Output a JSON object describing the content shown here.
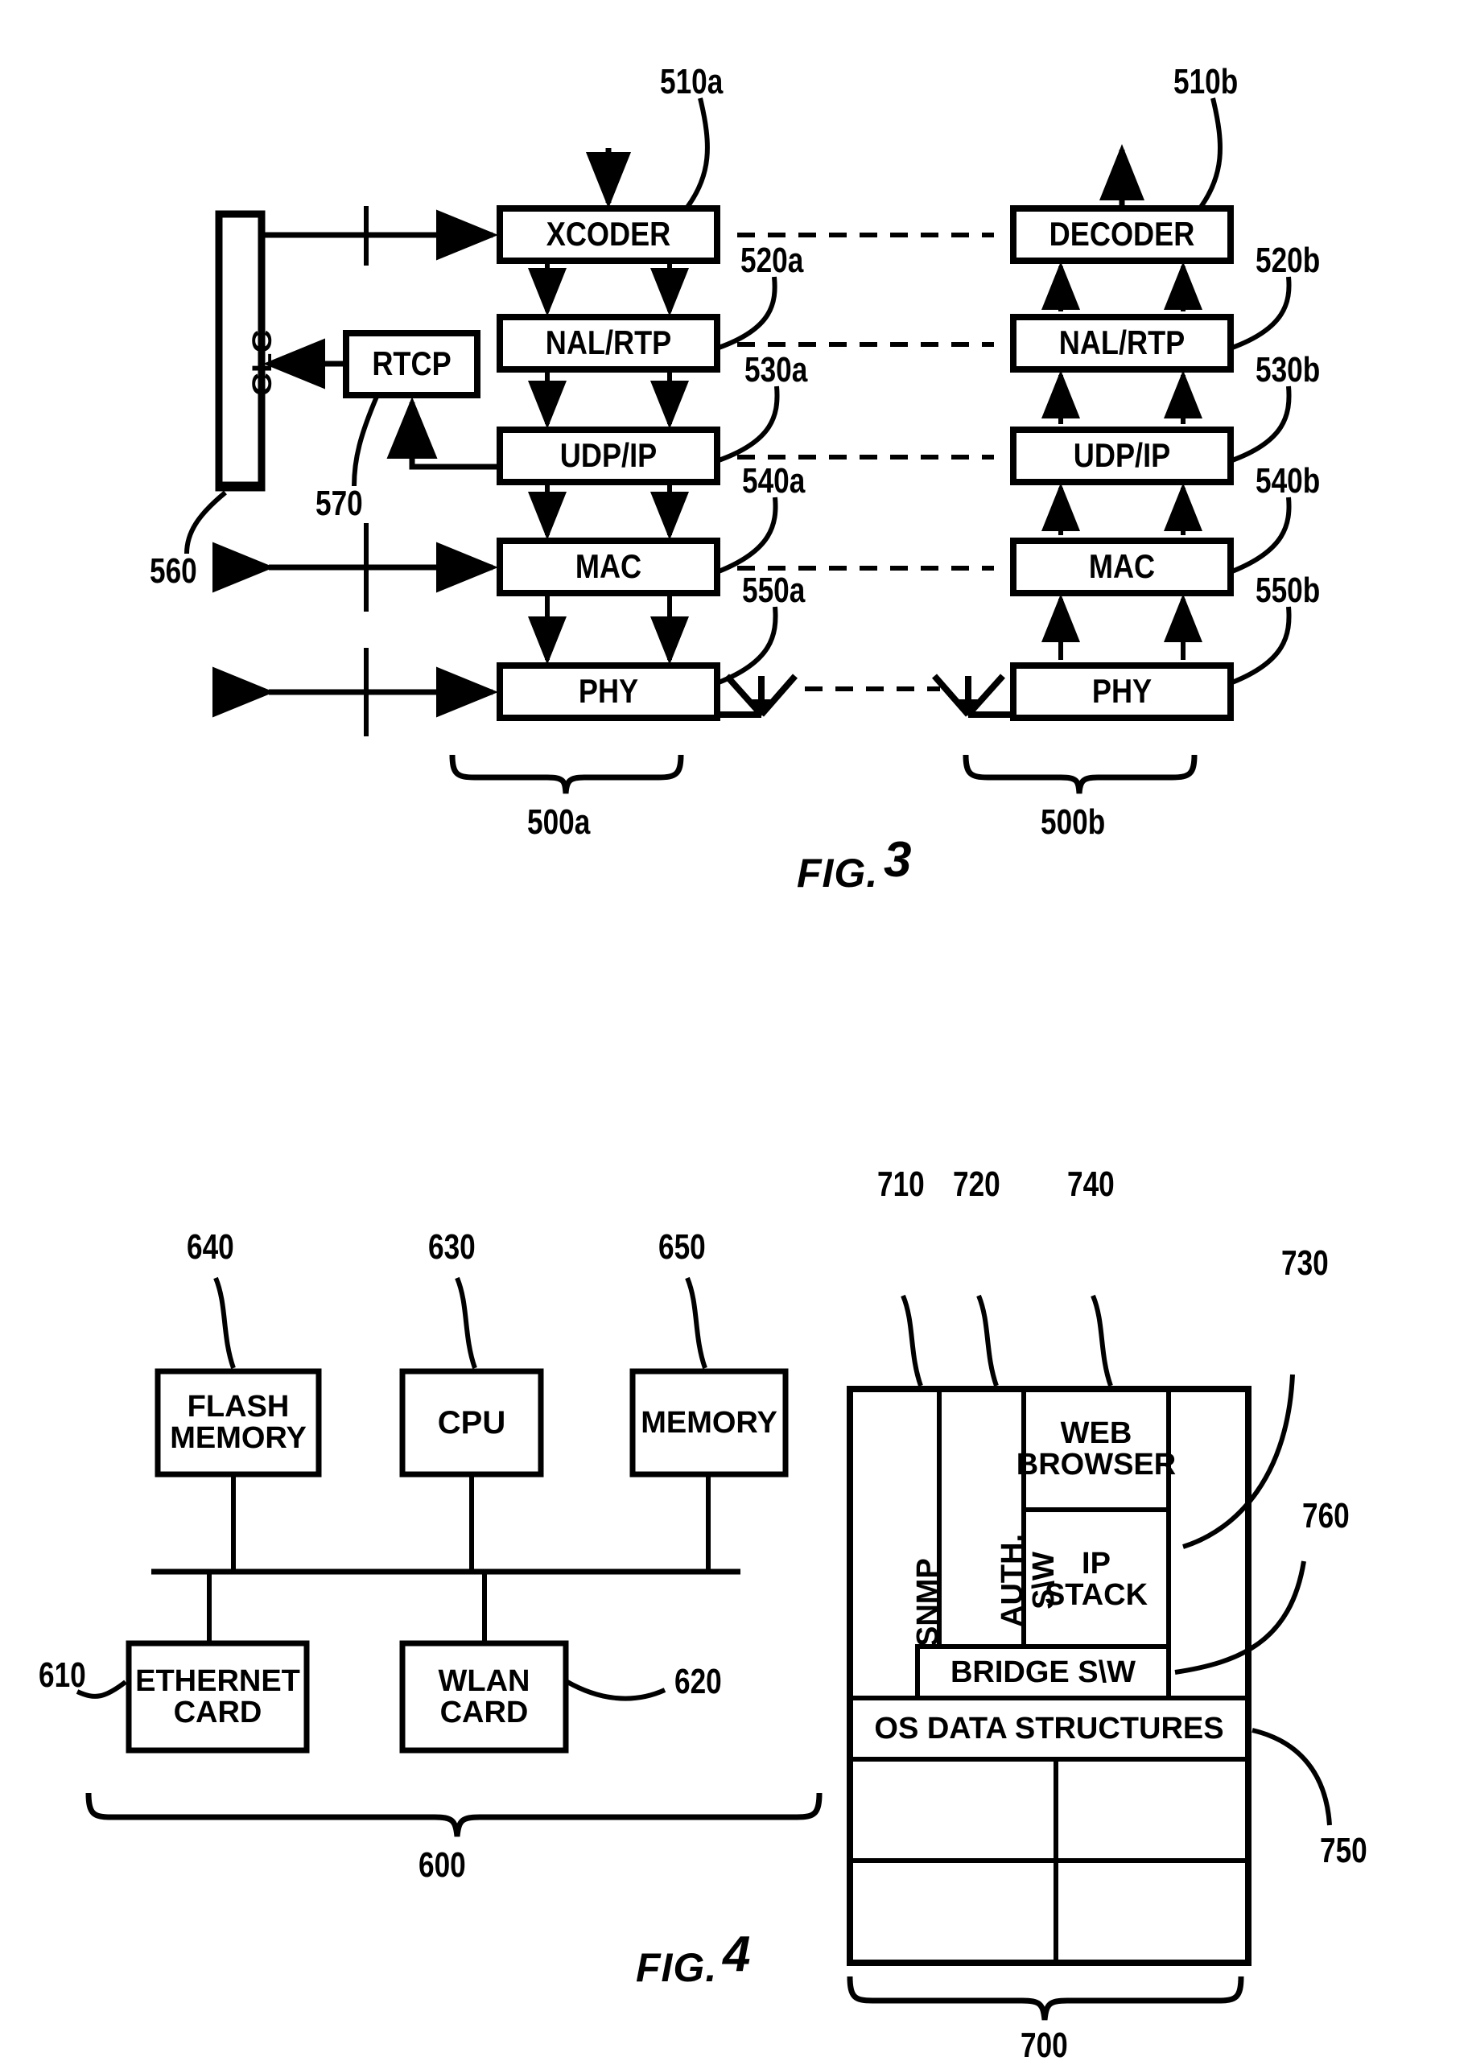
{
  "document": {
    "type": "patent-drawing-sheet",
    "figures": [
      "FIG. 3",
      "FIG. 4"
    ]
  },
  "fig3": {
    "label_prefix": "FIG.",
    "label_number": "3",
    "clc_block": {
      "text": "CLC",
      "ref": "560"
    },
    "rtcp_block": {
      "text": "RTCP",
      "ref": "570"
    },
    "transmit_stack": {
      "ref": "500a",
      "layers": [
        {
          "text": "XCODER",
          "ref": "510a"
        },
        {
          "text": "NAL/RTP",
          "ref": "520a"
        },
        {
          "text": "UDP/IP",
          "ref": "530a"
        },
        {
          "text": "MAC",
          "ref": "540a"
        },
        {
          "text": "PHY",
          "ref": "550a"
        }
      ]
    },
    "receive_stack": {
      "ref": "500b",
      "layers": [
        {
          "text": "DECODER",
          "ref": "510b"
        },
        {
          "text": "NAL/RTP",
          "ref": "520b"
        },
        {
          "text": "UDP/IP",
          "ref": "530b"
        },
        {
          "text": "MAC",
          "ref": "540b"
        },
        {
          "text": "PHY",
          "ref": "550b"
        }
      ]
    }
  },
  "fig4": {
    "label_prefix": "FIG.",
    "label_number": "4",
    "hardware": {
      "ref": "600",
      "blocks": [
        {
          "text": "FLASH MEMORY",
          "line1": "FLASH",
          "line2": "MEMORY",
          "ref": "640"
        },
        {
          "text": "CPU",
          "line1": "CPU",
          "line2": "",
          "ref": "630"
        },
        {
          "text": "MEMORY",
          "line1": "MEMORY",
          "line2": "",
          "ref": "650"
        },
        {
          "text": "ETHERNET CARD",
          "line1": "ETHERNET",
          "line2": "CARD",
          "ref": "610"
        },
        {
          "text": "WLAN CARD",
          "line1": "WLAN",
          "line2": "CARD",
          "ref": "620"
        }
      ]
    },
    "software": {
      "ref": "700",
      "blocks": [
        {
          "text": "SNMP",
          "ref": "710",
          "orientation": "vertical"
        },
        {
          "text": "AUTH. S\\W",
          "ref": "720",
          "orientation": "vertical"
        },
        {
          "text": "WEB BROWSER",
          "line1": "WEB",
          "line2": "BROWSER",
          "ref": "740",
          "orientation": "horizontal"
        },
        {
          "text": "IP STACK",
          "line1": "IP",
          "line2": "STACK",
          "ref": "730",
          "orientation": "horizontal"
        },
        {
          "text": "BRIDGE S\\W",
          "ref": "760",
          "orientation": "horizontal"
        },
        {
          "text": "OS DATA STRUCTURES",
          "ref": "750",
          "orientation": "horizontal"
        }
      ]
    }
  },
  "colors": {
    "ink": "#000000",
    "paper": "#ffffff"
  }
}
